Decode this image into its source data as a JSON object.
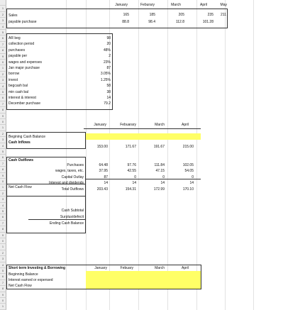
{
  "header": {
    "months": [
      "January",
      "Feburary",
      "March",
      "April",
      "May"
    ]
  },
  "top": {
    "sales": {
      "label": "Sales",
      "values": [
        "165",
        "185",
        "205",
        "235",
        "211"
      ]
    },
    "payable": {
      "label": "payable purchase",
      "values": [
        "88.8",
        "98.4",
        "112.8",
        "101.28"
      ]
    }
  },
  "params": [
    {
      "label": "AR beg",
      "value": "98"
    },
    {
      "label": "collection period",
      "value": "20"
    },
    {
      "label": "purchases",
      "value": "48%"
    },
    {
      "label": "payable per",
      "value": "2"
    },
    {
      "label": "wages and expenses",
      "value": "23%"
    },
    {
      "label": "Jan major purchase",
      "value": "87"
    },
    {
      "label": "borrow",
      "value": "3.05%"
    },
    {
      "label": "invest",
      "value": "1.25%"
    },
    {
      "label": "begcash bal",
      "value": "58"
    },
    {
      "label": "min cash bal",
      "value": "38"
    },
    {
      "label": "interest & interest",
      "value": "14"
    },
    {
      "label": "December purchase",
      "value": "79.2"
    }
  ],
  "section2": {
    "months": [
      "January",
      "Febuarary",
      "March",
      "April"
    ],
    "beg_cash": "Begining Cash Balance",
    "cash_inflows": {
      "label": "Cash Inflows",
      "values": [
        "153.00",
        "171.67",
        "191.67",
        "215.00"
      ]
    },
    "cash_outflows": "Cash Outflows",
    "outflows": [
      {
        "label": "Purchases",
        "values": [
          "64.48",
          "97.76",
          "111.84",
          "102.05"
        ]
      },
      {
        "label": "wages, taxes, etc.",
        "values": [
          "37.95",
          "42.55",
          "47.15",
          "54.05"
        ]
      },
      {
        "label": "Capital Outlay",
        "values": [
          "87",
          "0",
          "0",
          "0"
        ]
      },
      {
        "label": "Interest and dividends",
        "values": [
          "14",
          "14",
          "14",
          "14"
        ]
      },
      {
        "label": "Total Outflows",
        "values": [
          "203.43",
          "154.31",
          "172.99",
          "170.10"
        ]
      }
    ],
    "net_cash_flow": "Net Cash Flow",
    "cash_subtotal": "Cash Subtotal",
    "surplus": "Surplus/defecit",
    "ending": "Ending Cash Balance"
  },
  "section3": {
    "title": "Short term Investing & Borrowing",
    "months": [
      "January",
      "Febuary",
      "March",
      "April"
    ],
    "rows": [
      "Beginning Balance",
      "Interest earned or expensed",
      "Net Cash Flow"
    ]
  },
  "colors": {
    "highlight": "#ffff66"
  }
}
